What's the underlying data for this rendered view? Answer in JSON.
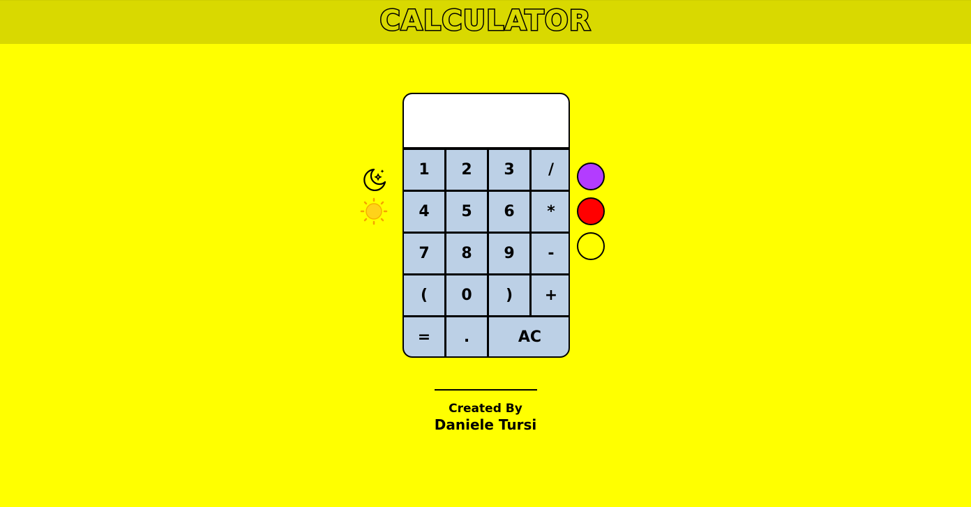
{
  "header": {
    "title": "CALCULATOR"
  },
  "display": {
    "value": ""
  },
  "keys": {
    "k1": "1",
    "k2": "2",
    "k3": "3",
    "div": "/",
    "k4": "4",
    "k5": "5",
    "k6": "6",
    "mul": "*",
    "k7": "7",
    "k8": "8",
    "k9": "9",
    "sub": "-",
    "lparen": "(",
    "k0": "0",
    "rparen": ")",
    "add": "+",
    "eq": "=",
    "dot": ".",
    "ac": "AC"
  },
  "theme": {
    "dark_icon": "moon-icon",
    "light_icon": "sun-icon"
  },
  "colors": {
    "background": "#ffff00",
    "header": "#d9d900",
    "key": "#bcd0e6",
    "swatch_purple": "#b33cff",
    "swatch_red": "#ff0000",
    "swatch_yellow": "#ffff00"
  },
  "footer": {
    "created_by": "Created By",
    "author": "Daniele Tursi"
  }
}
